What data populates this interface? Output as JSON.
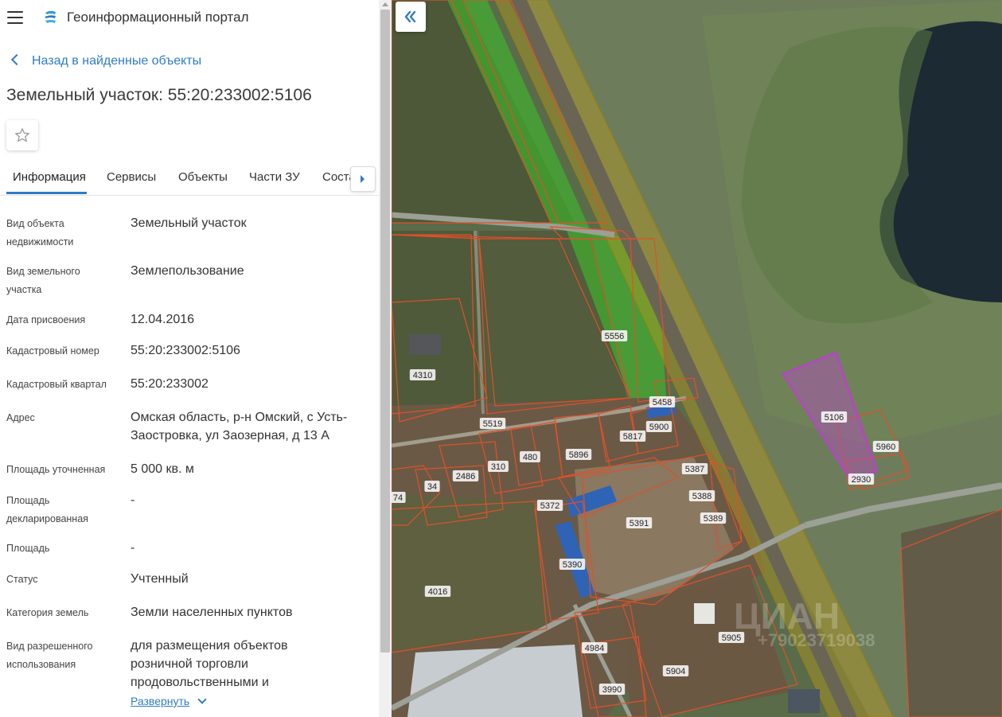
{
  "header": {
    "title": "Геоинформационный портал"
  },
  "back_link": "Назад в найденные объекты",
  "page_title": "Земельный участок: 55:20:233002:5106",
  "tabs": [
    {
      "label": "Информация",
      "active": true
    },
    {
      "label": "Сервисы"
    },
    {
      "label": "Объекты"
    },
    {
      "label": "Части ЗУ"
    },
    {
      "label": "Соста"
    }
  ],
  "properties": [
    {
      "label": "Вид объекта недвижимости",
      "value": "Земельный участок"
    },
    {
      "label": "Вид земельного участка",
      "value": "Землепользование"
    },
    {
      "label": "Дата присвоения",
      "value": "12.04.2016"
    },
    {
      "label": "Кадастровый номер",
      "value": "55:20:233002:5106"
    },
    {
      "label": "Кадастровый квартал",
      "value": "55:20:233002"
    },
    {
      "label": "Адрес",
      "value": "Омская область, р-н Омский, с Усть-Заостровка, ул Заозерная, д 13 А"
    },
    {
      "label": "Площадь уточненная",
      "value": "5 000 кв. м"
    },
    {
      "label": "Площадь декларированная",
      "value": "-"
    },
    {
      "label": "Площадь",
      "value": "-"
    },
    {
      "label": "Статус",
      "value": "Учтенный"
    },
    {
      "label": "Категория земель",
      "value": "Земли населенных пунктов"
    },
    {
      "label": "Вид разрешенного использования",
      "value": "для размещения объектов розничной торговли продовольственными и"
    }
  ],
  "expand_link": "Развернуть",
  "map": {
    "parcel_labels": [
      "5556",
      "4310",
      "5519",
      "5458",
      "5900",
      "5817",
      "5896",
      "480",
      "310",
      "2486",
      "34",
      "74",
      "5372",
      "5387",
      "5388",
      "5389",
      "5391",
      "5390",
      "4016",
      "4984",
      "3990",
      "5905",
      "5904",
      "5106",
      "5960",
      "2930"
    ],
    "watermark": "ЦИАН",
    "watermark_phone": "+79023719038"
  },
  "colors": {
    "accent": "#2f7bc8",
    "parcel_border": "#e0502a",
    "selected_parcel": "#c23ad6"
  },
  "icons": [
    "menu-icon",
    "portal-logo-icon",
    "chevron-left-icon",
    "star-icon",
    "caret-right-icon",
    "chevron-down-icon",
    "double-chevron-left-icon"
  ]
}
